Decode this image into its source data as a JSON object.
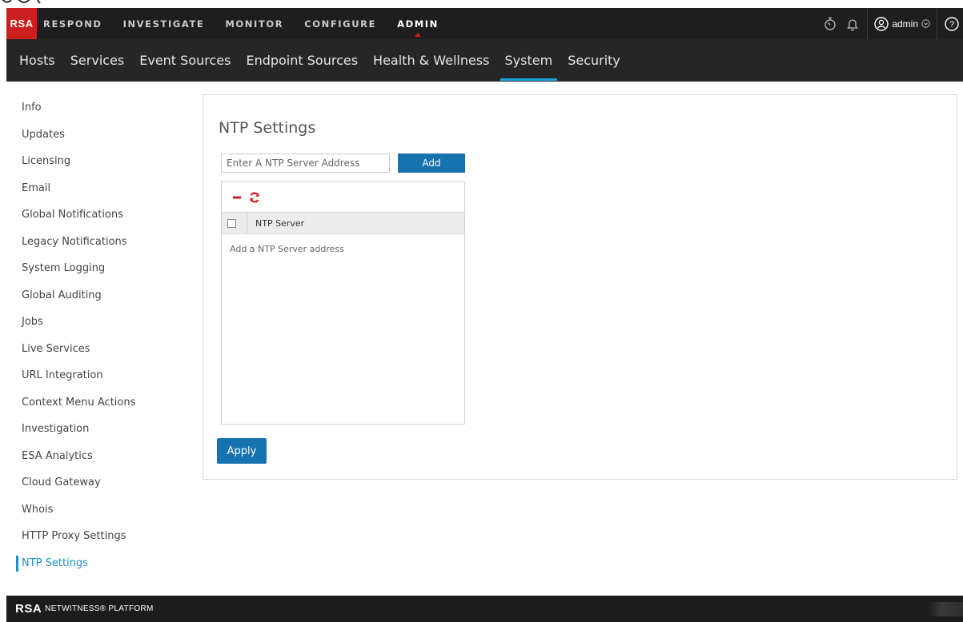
{
  "header": {
    "brand": "RSA",
    "nav": [
      {
        "label": "RESPOND",
        "active": false
      },
      {
        "label": "INVESTIGATE",
        "active": false
      },
      {
        "label": "MONITOR",
        "active": false
      },
      {
        "label": "CONFIGURE",
        "active": false
      },
      {
        "label": "ADMIN",
        "active": true
      }
    ],
    "icons": [
      "stopwatch-icon",
      "bell-icon",
      "user-icon",
      "chevron-down-icon",
      "help-icon"
    ],
    "user": "admin"
  },
  "subnav": {
    "items": [
      {
        "label": "Hosts",
        "active": false
      },
      {
        "label": "Services",
        "active": false
      },
      {
        "label": "Event Sources",
        "active": false
      },
      {
        "label": "Endpoint Sources",
        "active": false
      },
      {
        "label": "Health & Wellness",
        "active": false
      },
      {
        "label": "System",
        "active": true
      },
      {
        "label": "Security",
        "active": false
      }
    ]
  },
  "sidebar": {
    "items": [
      {
        "label": "Info"
      },
      {
        "label": "Updates"
      },
      {
        "label": "Licensing"
      },
      {
        "label": "Email"
      },
      {
        "label": "Global Notifications"
      },
      {
        "label": "Legacy Notifications"
      },
      {
        "label": "System Logging"
      },
      {
        "label": "Global Auditing"
      },
      {
        "label": "Jobs"
      },
      {
        "label": "Live Services"
      },
      {
        "label": "URL Integration"
      },
      {
        "label": "Context Menu Actions"
      },
      {
        "label": "Investigation"
      },
      {
        "label": "ESA Analytics"
      },
      {
        "label": "Cloud Gateway"
      },
      {
        "label": "Whois"
      },
      {
        "label": "HTTP Proxy Settings"
      },
      {
        "label": "NTP Settings"
      }
    ],
    "active_index": 17
  },
  "main": {
    "title": "NTP Settings",
    "input_placeholder": "Enter A NTP Server Address",
    "add_label": "Add",
    "grid": {
      "toolbar_icons": [
        "remove-icon",
        "refresh-icon"
      ],
      "column": "NTP Server",
      "empty_text": "Add a NTP Server address"
    },
    "apply_label": "Apply"
  },
  "footer": {
    "brand": "RSA",
    "product": "NETWITNESS® PLATFORM"
  },
  "colors": {
    "brand_red": "#cc1f1f",
    "accent_blue": "#1772b0",
    "active_blue": "#1a8fc8",
    "tab_underline": "#1aa3dd"
  }
}
